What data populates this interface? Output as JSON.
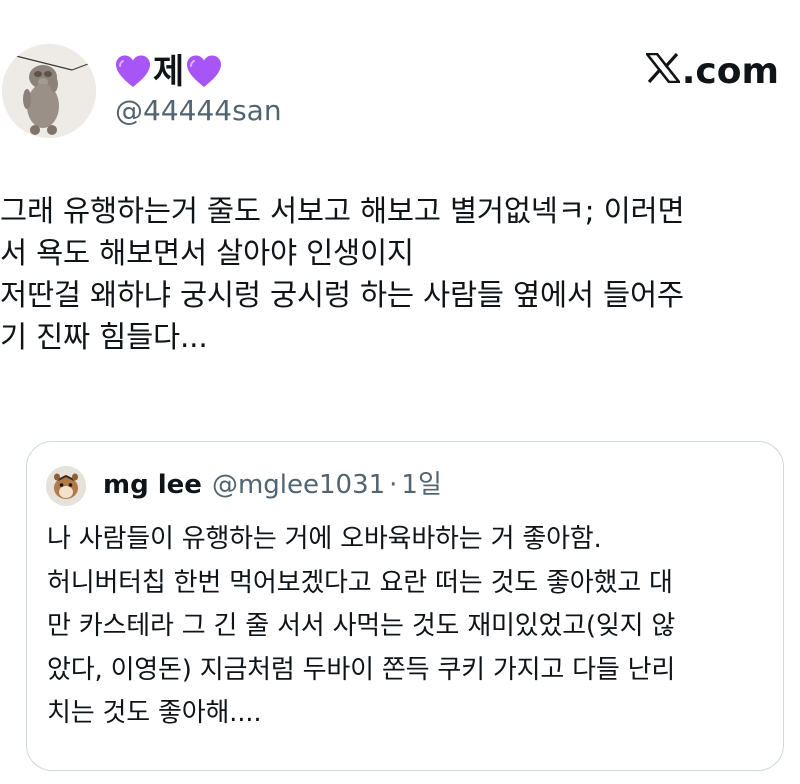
{
  "author": {
    "display_name": "제",
    "name_emoji_icon": "purple-heart-icon",
    "handle": "@44444san"
  },
  "brand": {
    "label": ".com",
    "logo_icon": "x-logo-icon"
  },
  "tweet": {
    "lines": [
      "그래 유행하는거 줄도 서보고 해보고 별거없넥ㅋ; 이러면",
      "서 욕도 해보면서 살아야 인생이지",
      "저딴걸 왜하냐 궁시렁 궁시렁 하는 사람들 옆에서 들어주",
      "기 진짜 힘들다..."
    ]
  },
  "quoted_tweet": {
    "display_name": "mg lee",
    "handle": "@mglee1031",
    "separator": "·",
    "time": "1일",
    "lines": [
      "나 사람들이 유행하는 거에 오바육바하는 거 좋아함.",
      "허니버터칩 한번 먹어보겠다고 요란 떠는 것도 좋아했고 대",
      "만 카스테라 그 긴 줄 서서 사먹는 것도 재미있었고(잊지 않",
      "았다, 이영돈) 지금처럼 두바이 쫀득 쿠키 가지고 다들 난리",
      "치는 것도 좋아해...."
    ]
  },
  "colors": {
    "text": "#0f1419",
    "secondary": "#536471",
    "border": "#cfd9de",
    "heart": "#a855f7"
  }
}
